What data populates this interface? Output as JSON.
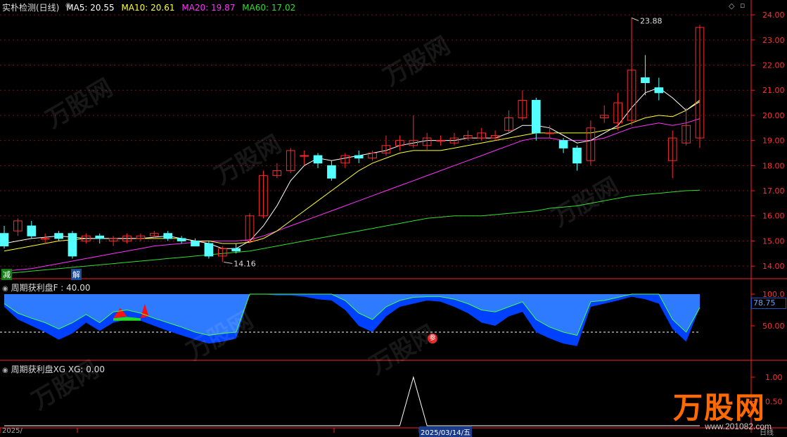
{
  "main": {
    "title": "实朴检测(日线)",
    "ma_legend": [
      {
        "label": "MA5: 20.55",
        "color": "#ffffff"
      },
      {
        "label": "MA10: 20.61",
        "color": "#ffff33"
      },
      {
        "label": "MA20: 19.87",
        "color": "#ff33ff"
      },
      {
        "label": "MA60: 17.02",
        "color": "#33dd33"
      }
    ],
    "y_ticks": [
      "24.00",
      "23.00",
      "22.00",
      "21.00",
      "20.00",
      "19.00",
      "18.00",
      "17.00",
      "16.00",
      "15.00",
      "14.00"
    ],
    "y_range": [
      13.5,
      24.2
    ],
    "high_annotation": "23.88",
    "low_annotation": "14.16",
    "signal_sell": "减",
    "signal_buy": "解"
  },
  "panel2": {
    "title": "周期获利盘F : 40.00",
    "y_ticks": [
      "100.0",
      "50.00"
    ],
    "current_value": "78.75",
    "badge": "参"
  },
  "panel3": {
    "title": "周期获利盘XG XG: 0.00",
    "y_ticks": [
      "1.00",
      "0.50"
    ]
  },
  "bottom_axis": {
    "labels": [
      "2025/",
      "2025/03/14/五",
      "日线"
    ]
  },
  "chart_data": {
    "type": "candlestick",
    "candles": [
      [
        15.3,
        14.8,
        15.6,
        14.7
      ],
      [
        15.4,
        15.8,
        15.9,
        15.2
      ],
      [
        15.6,
        15.2,
        15.8,
        15.1
      ],
      [
        15.1,
        15.1,
        15.3,
        14.9
      ],
      [
        15.3,
        15.1,
        15.4,
        15.0
      ],
      [
        15.3,
        14.4,
        15.4,
        14.3
      ],
      [
        15.0,
        15.2,
        15.3,
        14.9
      ],
      [
        15.2,
        15.1,
        15.3,
        14.9
      ],
      [
        15.0,
        15.1,
        15.2,
        14.8
      ],
      [
        15.0,
        15.2,
        15.3,
        14.9
      ],
      [
        15.1,
        15.2,
        15.3,
        15.0
      ],
      [
        15.2,
        15.3,
        15.4,
        15.1
      ],
      [
        15.3,
        15.1,
        15.4,
        15.0
      ],
      [
        15.1,
        15.0,
        15.2,
        14.9
      ],
      [
        15.0,
        14.8,
        15.1,
        14.8
      ],
      [
        14.9,
        14.4,
        15.0,
        14.3
      ],
      [
        14.4,
        14.7,
        14.8,
        14.16
      ],
      [
        14.7,
        14.6,
        14.9,
        14.5
      ],
      [
        15.0,
        16.0,
        16.1,
        14.9
      ],
      [
        16.0,
        17.6,
        17.8,
        15.9
      ],
      [
        17.6,
        17.8,
        18.1,
        17.5
      ],
      [
        17.8,
        18.6,
        18.7,
        17.7
      ],
      [
        18.4,
        18.4,
        18.6,
        18.0
      ],
      [
        18.4,
        18.1,
        18.5,
        17.9
      ],
      [
        18.0,
        17.5,
        18.2,
        17.4
      ],
      [
        18.1,
        18.4,
        18.5,
        17.9
      ],
      [
        18.4,
        18.3,
        18.6,
        18.1
      ],
      [
        18.3,
        18.5,
        18.6,
        18.2
      ],
      [
        18.5,
        18.8,
        19.2,
        18.4
      ],
      [
        18.8,
        19.0,
        19.2,
        18.6
      ],
      [
        18.8,
        19.0,
        20.0,
        18.7
      ],
      [
        18.8,
        19.1,
        19.3,
        18.6
      ],
      [
        19.0,
        19.0,
        19.2,
        18.8
      ],
      [
        18.9,
        19.1,
        19.3,
        18.8
      ],
      [
        19.1,
        19.2,
        19.4,
        19.0
      ],
      [
        19.1,
        19.3,
        19.5,
        19.0
      ],
      [
        19.1,
        19.2,
        19.4,
        19.0
      ],
      [
        19.4,
        19.9,
        20.2,
        19.3
      ],
      [
        19.9,
        20.6,
        21.0,
        19.8
      ],
      [
        20.6,
        19.3,
        20.7,
        19.0
      ],
      [
        19.3,
        19.3,
        19.6,
        19.1
      ],
      [
        19.0,
        18.7,
        19.1,
        18.5
      ],
      [
        18.7,
        18.1,
        18.8,
        17.8
      ],
      [
        18.2,
        19.5,
        19.8,
        18.0
      ],
      [
        19.9,
        20.0,
        20.4,
        19.7
      ],
      [
        19.7,
        20.5,
        20.9,
        19.4
      ],
      [
        19.8,
        21.8,
        23.88,
        19.6
      ],
      [
        21.5,
        21.3,
        22.4,
        20.8
      ],
      [
        21.1,
        20.9,
        21.5,
        20.6
      ],
      [
        18.2,
        19.1,
        19.4,
        17.5
      ],
      [
        18.9,
        19.6,
        20.3,
        18.8
      ],
      [
        19.1,
        23.5,
        23.6,
        18.7
      ]
    ],
    "ma5": [
      14.9,
      15.0,
      15.1,
      15.15,
      15.2,
      15.15,
      15.1,
      15.1,
      15.1,
      15.1,
      15.1,
      15.15,
      15.2,
      15.1,
      15.0,
      14.9,
      14.7,
      14.7,
      15.0,
      15.6,
      16.4,
      17.4,
      18.0,
      18.3,
      18.2,
      18.3,
      18.4,
      18.5,
      18.6,
      18.8,
      18.9,
      19.0,
      19.0,
      19.0,
      19.1,
      19.1,
      19.1,
      19.3,
      19.6,
      19.6,
      19.5,
      19.2,
      18.9,
      19.0,
      19.3,
      19.6,
      20.3,
      20.9,
      21.1,
      20.7,
      20.2,
      20.55
    ],
    "ma10": [
      14.6,
      14.7,
      14.8,
      14.9,
      15.0,
      15.05,
      15.1,
      15.1,
      15.1,
      15.1,
      15.1,
      15.1,
      15.1,
      15.1,
      15.0,
      15.0,
      14.9,
      14.9,
      14.95,
      15.1,
      15.4,
      15.8,
      16.2,
      16.6,
      17.0,
      17.4,
      17.8,
      18.1,
      18.3,
      18.5,
      18.6,
      18.6,
      18.6,
      18.7,
      18.8,
      18.9,
      19.0,
      19.1,
      19.2,
      19.3,
      19.3,
      19.3,
      19.3,
      19.3,
      19.4,
      19.5,
      19.7,
      19.9,
      20.0,
      19.95,
      20.2,
      20.61
    ],
    "ma20": [
      13.8,
      13.85,
      13.9,
      14.0,
      14.1,
      14.2,
      14.3,
      14.4,
      14.5,
      14.6,
      14.7,
      14.8,
      14.85,
      14.9,
      14.95,
      15.0,
      15.0,
      15.0,
      15.05,
      15.2,
      15.4,
      15.6,
      15.8,
      16.0,
      16.2,
      16.4,
      16.6,
      16.8,
      17.0,
      17.2,
      17.4,
      17.6,
      17.8,
      18.0,
      18.2,
      18.4,
      18.6,
      18.8,
      19.0,
      19.1,
      19.1,
      19.0,
      19.0,
      19.0,
      19.1,
      19.3,
      19.5,
      19.6,
      19.7,
      19.6,
      19.7,
      19.87
    ],
    "ma60": [
      13.7,
      13.75,
      13.8,
      13.85,
      13.9,
      13.95,
      14.0,
      14.05,
      14.1,
      14.15,
      14.2,
      14.25,
      14.3,
      14.35,
      14.4,
      14.45,
      14.5,
      14.55,
      14.6,
      14.7,
      14.8,
      14.9,
      15.0,
      15.1,
      15.2,
      15.3,
      15.4,
      15.5,
      15.6,
      15.7,
      15.8,
      15.9,
      15.95,
      16.0,
      16.0,
      16.0,
      16.05,
      16.1,
      16.15,
      16.2,
      16.3,
      16.35,
      16.4,
      16.5,
      16.6,
      16.7,
      16.8,
      16.85,
      16.9,
      16.95,
      17.0,
      17.02
    ],
    "profit_outer": [
      85,
      70,
      62,
      55,
      45,
      55,
      68,
      55,
      72,
      75,
      70,
      62,
      55,
      48,
      40,
      35,
      38,
      40,
      100,
      100,
      100,
      100,
      100,
      100,
      100,
      90,
      70,
      60,
      80,
      90,
      95,
      96,
      96,
      92,
      85,
      75,
      72,
      80,
      88,
      60,
      48,
      40,
      35,
      88,
      90,
      95,
      100,
      100,
      100,
      60,
      40,
      78.75
    ],
    "profit_inner": [
      80,
      60,
      50,
      40,
      28,
      38,
      55,
      42,
      55,
      60,
      58,
      50,
      42,
      35,
      28,
      22,
      25,
      30,
      100,
      100,
      98,
      98,
      96,
      92,
      90,
      75,
      50,
      40,
      65,
      80,
      85,
      90,
      88,
      80,
      70,
      55,
      50,
      65,
      72,
      40,
      30,
      22,
      18,
      80,
      85,
      90,
      96,
      92,
      85,
      45,
      25,
      78.75
    ],
    "profit_line": [
      85,
      70,
      62,
      55,
      45,
      55,
      68,
      55,
      72,
      75,
      70,
      62,
      55,
      48,
      40,
      35,
      38,
      40,
      100,
      100,
      100,
      100,
      100,
      100,
      100,
      90,
      70,
      60,
      80,
      90,
      95,
      96,
      96,
      92,
      85,
      75,
      72,
      80,
      88,
      60,
      48,
      40,
      35,
      88,
      90,
      95,
      100,
      100,
      100,
      60,
      40,
      78.75
    ],
    "profit_reference": 40,
    "xg_values": [
      0,
      0,
      0,
      0,
      0,
      0,
      0,
      0,
      0,
      0,
      0,
      0,
      0,
      0,
      0,
      0,
      0,
      0,
      0,
      0,
      0,
      0,
      0,
      0,
      0,
      0,
      0,
      0,
      0,
      0,
      1,
      0,
      0,
      0,
      0,
      0,
      0,
      0,
      0,
      0,
      0,
      0,
      0,
      0,
      0,
      0,
      0,
      0,
      0,
      0,
      0,
      0
    ],
    "colors": {
      "up": "#ff2a2a",
      "down": "#54ffff",
      "grid": "#7a1010",
      "axis": "#ff2020",
      "profit": "#0040ff",
      "profit_light": "#2f7bff"
    }
  }
}
